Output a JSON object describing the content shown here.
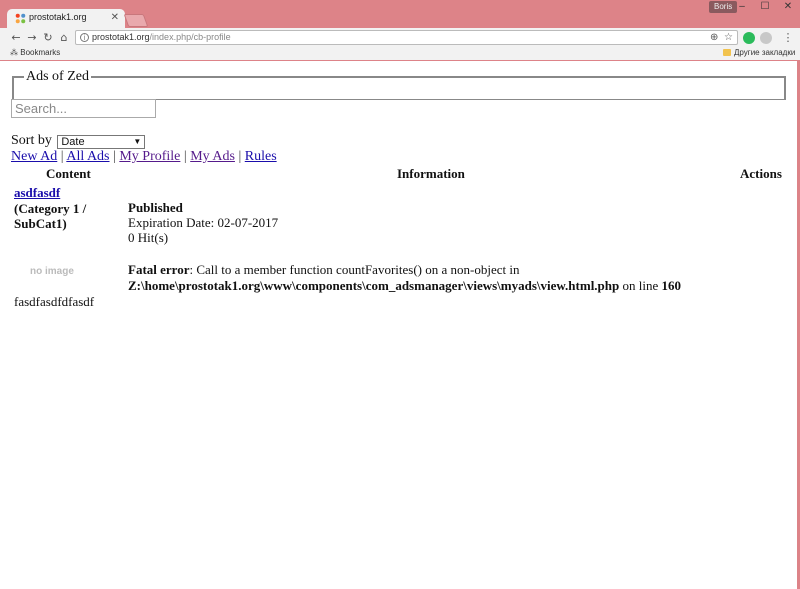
{
  "browser": {
    "tab_title": "prostotak1.org",
    "user": "Boris",
    "url_host": "prostotak1.org",
    "url_path": "/index.php/cb-profile",
    "bookmarks_label": "Bookmarks",
    "other_bookmarks": "Другие закладки"
  },
  "page": {
    "fieldset_legend": "Ads of Zed",
    "search_placeholder": "Search...",
    "sort_label": "Sort by",
    "sort_value": "Date",
    "links": [
      "New Ad",
      "All Ads",
      "My Profile",
      "My Ads",
      "Rules"
    ],
    "separator": "|",
    "columns": [
      "Content",
      "Information",
      "Actions"
    ],
    "ad": {
      "title": "asdfasdf",
      "category": "(Category 1 / SubCat1)",
      "status": "Published",
      "expiration": "Expiration Date: 02-07-2017",
      "hits": "0 Hit(s)",
      "no_image": "no image",
      "description": "fasdfasdfdfasdf"
    },
    "error": {
      "label": "Fatal error",
      "message": ": Call to a member function countFavorites() on a non-object in",
      "path": "Z:\\home\\prostotak1.org\\www\\components\\com_adsmanager\\views\\myads\\view.html.php",
      "line_text": " on line ",
      "line_number": "160"
    }
  }
}
